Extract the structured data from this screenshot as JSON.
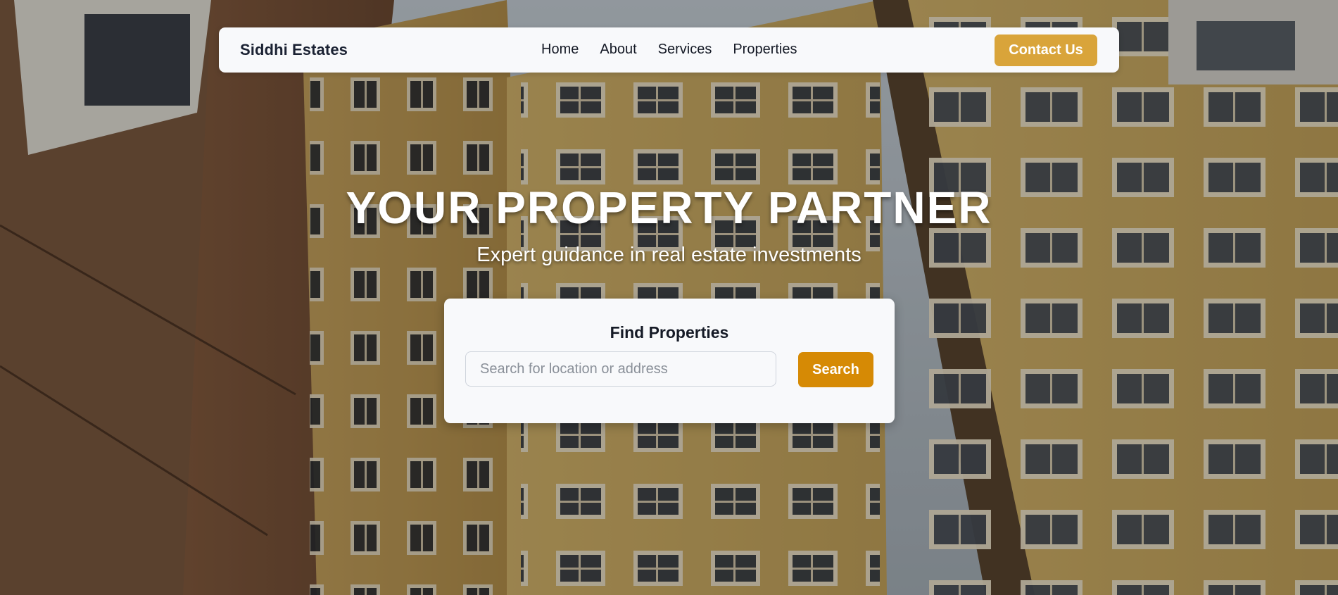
{
  "nav": {
    "brand": "Siddhi Estates",
    "links": [
      "Home",
      "About",
      "Services",
      "Properties"
    ],
    "contact_label": "Contact Us"
  },
  "hero": {
    "title": "YOUR PROPERTY PARTNER",
    "subtitle": "Expert guidance in real estate investments"
  },
  "search": {
    "title": "Find Properties",
    "placeholder": "Search for location or address",
    "value": "",
    "button_label": "Search"
  },
  "colors": {
    "accent": "#d9a43a",
    "search_button": "#d68a05",
    "card_bg": "#f8f9fb",
    "text_dark": "#151a26"
  },
  "background": {
    "description_icon": "building-photo"
  }
}
